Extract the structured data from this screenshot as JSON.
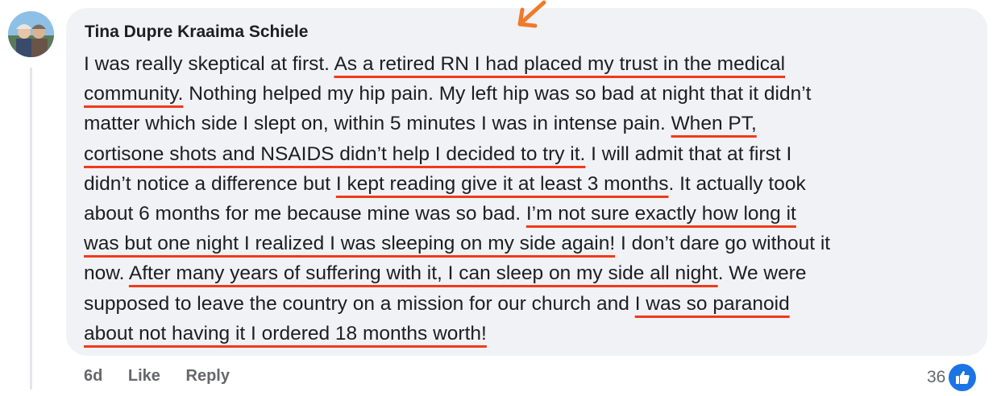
{
  "comment": {
    "author": "Tina Dupre Kraaima Schiele",
    "lines": [
      [
        "I was really skeptical at first. ",
        "As a retired RN I had placed my trust in the medical"
      ],
      [
        "community.",
        " Nothing helped my hip pain. My left hip was so bad at night that it didn’t"
      ],
      [
        "matter which side I slept on, within 5 minutes I was in intense pain. ",
        "When PT,"
      ],
      [
        "cortisone shots and NSAIDS didn’t help I decided to try it.",
        " I will admit that at first I"
      ],
      [
        "didn’t notice a difference but ",
        "I kept reading give it at least 3 months",
        ". It actually took"
      ],
      [
        "about 6 months for me because mine was so bad. ",
        "I’m not sure exactly how long it"
      ],
      [
        "was but one night I realized I was sleeping on my side again!",
        " I don’t dare go without it"
      ],
      [
        "now. ",
        "After many years of suffering with it, I can sleep on my side all night",
        ". We were"
      ],
      [
        "supposed to leave the country on a mission for our church and ",
        "I was so paranoid"
      ],
      [
        "about not having it I ordered 18 months worth!"
      ]
    ]
  },
  "actions": {
    "time": "6d",
    "like": "Like",
    "reply": "Reply"
  },
  "reactions": {
    "count": "36",
    "icon": "thumbs-up-icon"
  },
  "colors": {
    "underline": "#f03a1a",
    "bubble": "#f0f2f5",
    "like_blue": "#1b74e4"
  }
}
